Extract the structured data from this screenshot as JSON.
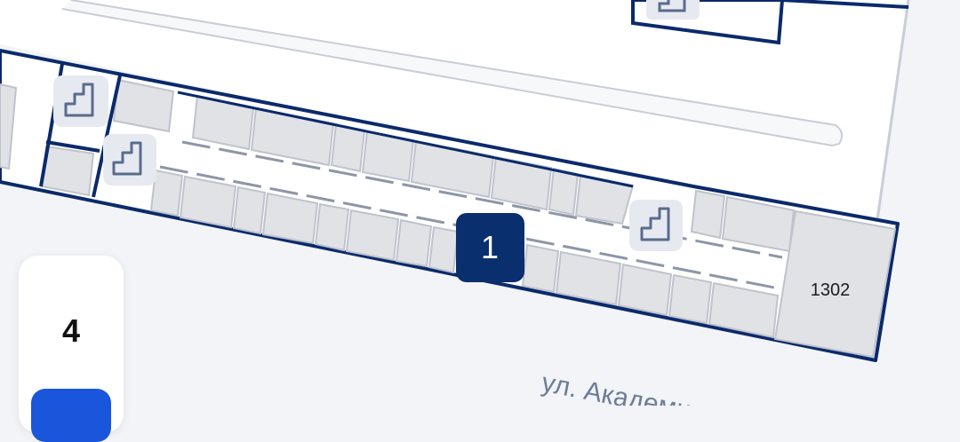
{
  "colors": {
    "background": "#f2f4f7",
    "building_fill": "#ffffff",
    "wall": "#0b2a6b",
    "room_fill": "#e1e2e6",
    "room_stroke": "#bfc3cc",
    "corridor": "#ffffff",
    "marker_bg": "#0a2f6e",
    "marker_text": "#ffffff",
    "stair_bg": "#e6e9f0",
    "stair_icon": "#5a6b8c",
    "street_label": "#6d7d96",
    "active_floor": "#1a56db"
  },
  "map": {
    "room_label": "1302",
    "marker_label": "1",
    "street_label": "ул. Академика П",
    "stairs_icon_name": "stairs-icon"
  },
  "floor_switcher": {
    "floor_label": "4"
  }
}
